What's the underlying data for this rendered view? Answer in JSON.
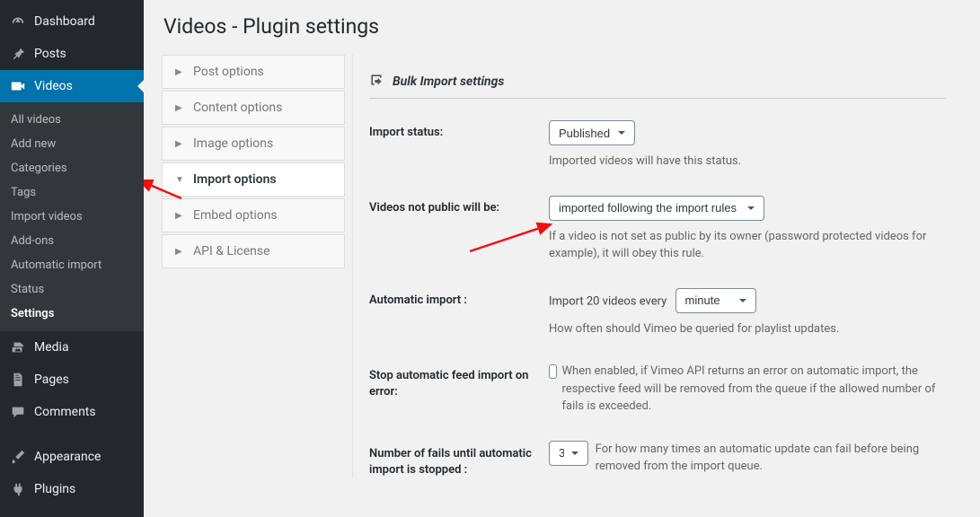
{
  "sidebar": {
    "items": [
      {
        "label": "Dashboard",
        "icon": "dashboard"
      },
      {
        "label": "Posts",
        "icon": "pin"
      },
      {
        "label": "Videos",
        "icon": "video",
        "open": true
      },
      {
        "label": "Media",
        "icon": "media"
      },
      {
        "label": "Pages",
        "icon": "page"
      },
      {
        "label": "Comments",
        "icon": "comment"
      },
      {
        "label": "Appearance",
        "icon": "brush"
      },
      {
        "label": "Plugins",
        "icon": "plug"
      }
    ],
    "submenu": [
      {
        "label": "All videos"
      },
      {
        "label": "Add new"
      },
      {
        "label": "Categories"
      },
      {
        "label": "Tags"
      },
      {
        "label": "Import videos"
      },
      {
        "label": "Add-ons"
      },
      {
        "label": "Automatic import"
      },
      {
        "label": "Status"
      },
      {
        "label": "Settings",
        "current": true
      }
    ]
  },
  "page": {
    "title": "Videos - Plugin settings"
  },
  "tabs": [
    {
      "label": "Post options"
    },
    {
      "label": "Content options"
    },
    {
      "label": "Image options"
    },
    {
      "label": "Import options",
      "active": true
    },
    {
      "label": "Embed options"
    },
    {
      "label": "API & License"
    }
  ],
  "panel": {
    "title": "Bulk Import settings",
    "fields": {
      "status": {
        "label": "Import status:",
        "value": "Published",
        "help": "Imported videos will have this status."
      },
      "not_public": {
        "label": "Videos not public will be:",
        "value": "imported following the import rules",
        "help": "If a video is not set as public by its owner (password protected videos for example), it will obey this rule."
      },
      "auto_import": {
        "label": "Automatic import :",
        "prefix": "Import 20 videos every",
        "value": "minute",
        "help": "How often should Vimeo be queried for playlist updates."
      },
      "stop_on_error": {
        "label": "Stop automatic feed import on error:",
        "help": "When enabled, if Vimeo API returns an error on automatic import, the respective feed will be removed from the queue if the allowed number of fails is exceeded."
      },
      "fail_count": {
        "label": "Number of fails until automatic import is stopped :",
        "value": "3",
        "help": "For how many times an automatic update can fail before being removed from the import queue."
      }
    }
  }
}
